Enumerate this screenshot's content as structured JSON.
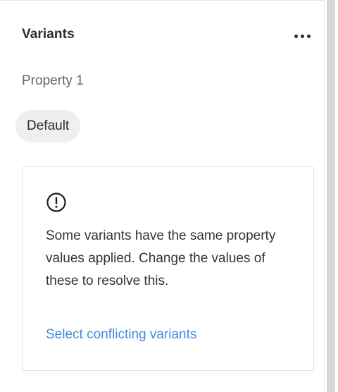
{
  "variants": {
    "title": "Variants",
    "more_icon": "more-horizontal-icon",
    "property_label": "Property 1",
    "property_value": "Default",
    "warning": {
      "icon": "exclamation-circle-icon",
      "message": "Some variants have the same property values applied. Change the values of these to resolve this.",
      "action_label": "Select conflicting variants"
    }
  },
  "colors": {
    "link": "#3d8ee0",
    "chip_background": "#efefef",
    "card_border": "#e3e3e3"
  }
}
